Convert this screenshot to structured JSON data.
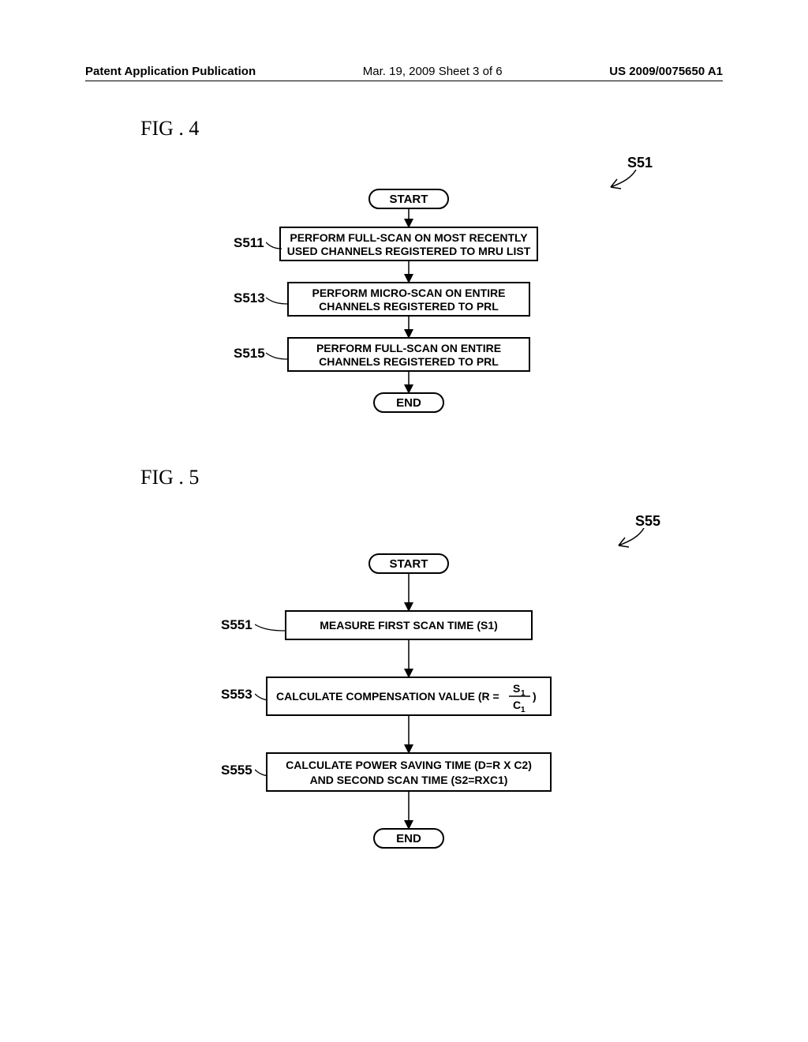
{
  "header": {
    "left": "Patent Application Publication",
    "mid": "Mar. 19, 2009  Sheet 3 of 6",
    "right": "US 2009/0075650 A1"
  },
  "fig4": {
    "label": "FIG . 4",
    "ref": "S51",
    "start": "START",
    "end": "END",
    "s511": {
      "tag": "S511",
      "l1": "PERFORM FULL-SCAN ON MOST RECENTLY",
      "l2": "USED CHANNELS REGISTERED TO MRU LIST"
    },
    "s513": {
      "tag": "S513",
      "l1": "PERFORM MICRO-SCAN ON ENTIRE",
      "l2": "CHANNELS REGISTERED TO PRL"
    },
    "s515": {
      "tag": "S515",
      "l1": "PERFORM FULL-SCAN ON ENTIRE",
      "l2": "CHANNELS REGISTERED TO PRL"
    }
  },
  "fig5": {
    "label": "FIG . 5",
    "ref": "S55",
    "start": "START",
    "end": "END",
    "s551": {
      "tag": "S551",
      "line": "MEASURE FIRST SCAN TIME (S1)"
    },
    "s553": {
      "tag": "S553",
      "prefix": "CALCULATE COMPENSATION VALUE  (R = ",
      "num": "S",
      "numsub": "1",
      "den": "C",
      "densub": "1",
      "suffix": ")"
    },
    "s555": {
      "tag": "S555",
      "l1": "CALCULATE POWER SAVING TIME (D=R X C2)",
      "l2": "AND SECOND SCAN TIME (S2=RXC1)"
    }
  }
}
